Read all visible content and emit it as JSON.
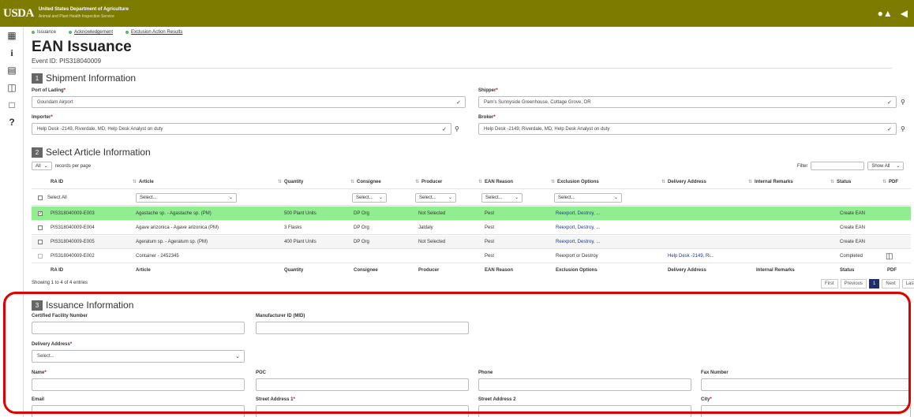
{
  "header": {
    "logo": "USDA",
    "agency_line1": "United States Department of Agriculture",
    "agency_line2": "Animal and Plant Health Inspection Service"
  },
  "steps": [
    "Issuance",
    "Acknowledgement",
    "Exclusion Action Results"
  ],
  "page": {
    "title": "EAN Issuance",
    "event_id": "Event ID: PIS318040009"
  },
  "shipment": {
    "num": "1",
    "title": "Shipment Information",
    "port_label": "Port of Lading",
    "port_value": "Goundam Airport",
    "shipper_label": "Shipper",
    "shipper_value": "Pam's Sunnyside Greenhouse, Cottage Grove, OR",
    "importer_label": "Importer",
    "importer_value": "Help Desk -2149, Riverdale, MD, Help Desk Analyst on duty",
    "broker_label": "Broker",
    "broker_value": "Help Desk -2149, Riverdale, MD, Help Desk Analyst on duty"
  },
  "articles": {
    "num": "2",
    "title": "Select Article Information",
    "page_size": "All",
    "records_label": "records per page",
    "filter_label": "Filter",
    "show_all": "Show All",
    "headers": [
      "RA ID",
      "Article",
      "Quantity",
      "Consignee",
      "Producer",
      "EAN Reason",
      "Exclusion Options",
      "Delivery Address",
      "Internal Remarks",
      "Status",
      "PDF"
    ],
    "select_all": "Select All",
    "select_placeholder": "Select...",
    "rows": [
      {
        "ra": "PIS318040009-E003",
        "article": "Agastache sp. - Agastache sp. (PM)",
        "qty": "500 Plant Units",
        "consignee": "DP Org",
        "producer": "Not Selected",
        "reason": "Pest",
        "excl": "Reexport, Destroy, ...",
        "addr": "",
        "remarks": "",
        "status": "Create EAN",
        "pdf": "",
        "checked": true
      },
      {
        "ra": "PIS318040009-E004",
        "article": "Agave arizonica - Agave arizonica (PM)",
        "qty": "3 Flasks",
        "consignee": "DP Org",
        "producer": "Jaldaly",
        "reason": "Pest",
        "excl": "Reexport, Destroy, ...",
        "addr": "",
        "remarks": "",
        "status": "Create EAN",
        "pdf": "",
        "checked": false
      },
      {
        "ra": "PIS318040009-E005",
        "article": "Ageratum sp. - Ageratum sp. (PM)",
        "qty": "400 Plant Units",
        "consignee": "DP Org",
        "producer": "Not Selected",
        "reason": "Pest",
        "excl": "Reexport, Destroy, ...",
        "addr": "",
        "remarks": "",
        "status": "Create EAN",
        "pdf": "",
        "checked": false
      },
      {
        "ra": "PIS318040009-E002",
        "article": "Container - 2452345",
        "qty": "",
        "consignee": "",
        "producer": "",
        "reason": "Pest",
        "excl": "Reexport or Destroy",
        "addr": "Help Desk -2149, Ri...",
        "remarks": "",
        "status": "Completed",
        "pdf": "pdf-icon",
        "checked": false
      }
    ],
    "showing": "Showing 1 to 4 of 4 entries",
    "pager": {
      "first": "First",
      "prev": "Previous",
      "current": "1",
      "next": "Next",
      "last": "Last"
    }
  },
  "issuance": {
    "num": "3",
    "title": "Issuance Information",
    "cert_label": "Certified Facility Number",
    "mid_label": "Manufacturer ID (MID)",
    "delivery_label": "Delivery Address",
    "delivery_value": "Select...",
    "name_label": "Name",
    "poc_label": "POC",
    "phone_label": "Phone",
    "fax_label": "Fax Number",
    "email_label": "Email",
    "street1_label": "Street Address 1",
    "street2_label": "Street Address 2",
    "city_label": "City"
  },
  "colors": {
    "banner": "#7d7b00",
    "highlight_row": "#90ee90",
    "annotation": "#e00000",
    "required": "#cc0000"
  }
}
